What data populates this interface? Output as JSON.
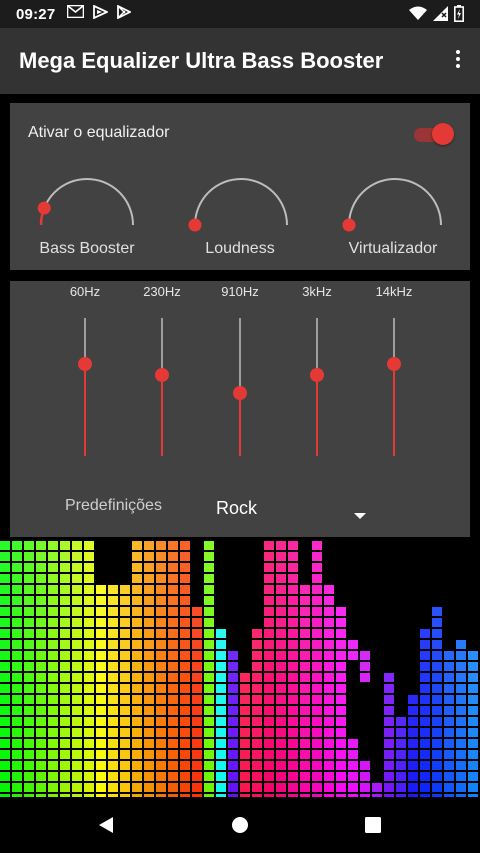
{
  "status_bar": {
    "time": "09:27",
    "left_icons": [
      "gmail-icon",
      "play-games-icon",
      "play-store-icon"
    ],
    "right_icons": [
      "wifi-icon",
      "signal-icon",
      "battery-icon"
    ]
  },
  "app_bar": {
    "title": "Mega Equalizer Ultra Bass Booster",
    "menu_icon": "overflow-menu-icon"
  },
  "effects_card": {
    "toggle_label": "Ativar o equalizador",
    "toggle_on": true,
    "knobs": [
      {
        "label": "Bass Booster",
        "level": 0.12
      },
      {
        "label": "Loudness",
        "level": 0.0
      },
      {
        "label": "Virtualizador",
        "level": 0.0
      }
    ]
  },
  "equalizer_card": {
    "bands": [
      {
        "label": "60Hz",
        "level": 0.67
      },
      {
        "label": "230Hz",
        "level": 0.59
      },
      {
        "label": "910Hz",
        "level": 0.46
      },
      {
        "label": "3kHz",
        "level": 0.59
      },
      {
        "label": "14kHz",
        "level": 0.67
      }
    ],
    "preset_label": "Predefinições",
    "preset_value": "Rock"
  },
  "nav_bar": {
    "buttons": [
      "back-icon",
      "home-icon",
      "recents-icon"
    ]
  },
  "colors": {
    "accent": "#e53935",
    "card": "#424242",
    "app_bar": "#333333",
    "status_bar": "#1c1c1c"
  }
}
